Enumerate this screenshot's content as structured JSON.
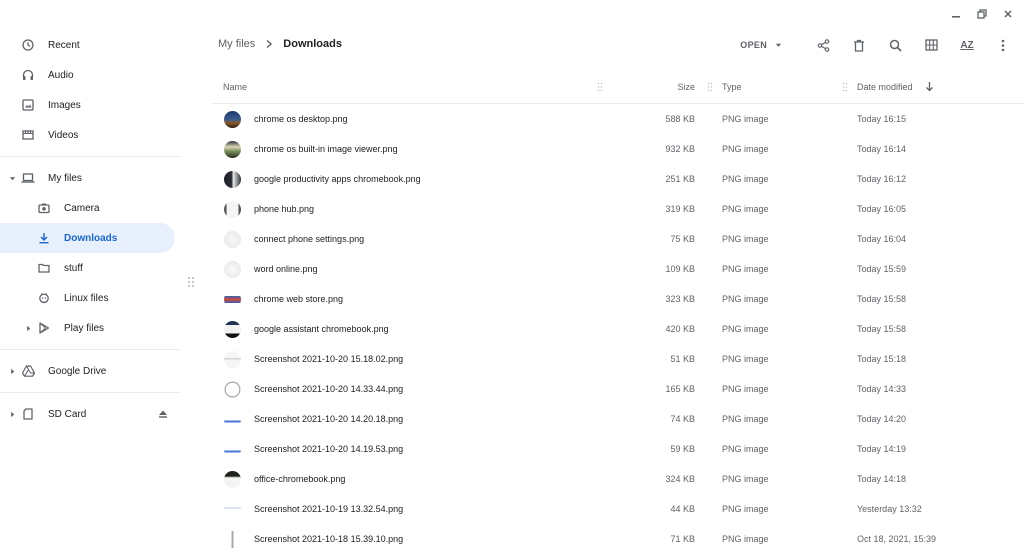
{
  "sidebar": {
    "recent": "Recent",
    "audio": "Audio",
    "images": "Images",
    "videos": "Videos",
    "my_files": "My files",
    "camera": "Camera",
    "downloads": "Downloads",
    "stuff": "stuff",
    "linux_files": "Linux files",
    "play_files": "Play files",
    "google_drive": "Google Drive",
    "sd_card": "SD Card"
  },
  "breadcrumb": {
    "root": "My files",
    "current": "Downloads"
  },
  "toolbar": {
    "open_label": "OPEN",
    "sort_label": "AZ"
  },
  "columns": {
    "name": "Name",
    "size": "Size",
    "type": "Type",
    "date": "Date modified"
  },
  "files": [
    {
      "name": "chrome os desktop.png",
      "size": "588 KB",
      "type": "PNG image",
      "date": "Today 16:15"
    },
    {
      "name": "chrome os built-in image viewer.png",
      "size": "932 KB",
      "type": "PNG image",
      "date": "Today 16:14"
    },
    {
      "name": "google productivity apps chromebook.png",
      "size": "251 KB",
      "type": "PNG image",
      "date": "Today 16:12"
    },
    {
      "name": "phone hub.png",
      "size": "319 KB",
      "type": "PNG image",
      "date": "Today 16:05"
    },
    {
      "name": "connect phone settings.png",
      "size": "75 KB",
      "type": "PNG image",
      "date": "Today 16:04"
    },
    {
      "name": "word online.png",
      "size": "109 KB",
      "type": "PNG image",
      "date": "Today 15:59"
    },
    {
      "name": "chrome web store.png",
      "size": "323 KB",
      "type": "PNG image",
      "date": "Today 15:58"
    },
    {
      "name": "google assistant chromebook.png",
      "size": "420 KB",
      "type": "PNG image",
      "date": "Today 15:58"
    },
    {
      "name": "Screenshot 2021-10-20 15.18.02.png",
      "size": "51 KB",
      "type": "PNG image",
      "date": "Today 15:18"
    },
    {
      "name": "Screenshot 2021-10-20 14.33.44.png",
      "size": "165 KB",
      "type": "PNG image",
      "date": "Today 14:33"
    },
    {
      "name": "Screenshot 2021-10-20 14.20.18.png",
      "size": "74 KB",
      "type": "PNG image",
      "date": "Today 14:20"
    },
    {
      "name": "Screenshot 2021-10-20 14.19.53.png",
      "size": "59 KB",
      "type": "PNG image",
      "date": "Today 14:19"
    },
    {
      "name": "office-chromebook.png",
      "size": "324 KB",
      "type": "PNG image",
      "date": "Today 14:18"
    },
    {
      "name": "Screenshot 2021-10-19 13.32.54.png",
      "size": "44 KB",
      "type": "PNG image",
      "date": "Yesterday 13:32"
    },
    {
      "name": "Screenshot 2021-10-18 15.39.10.png",
      "size": "71 KB",
      "type": "PNG image",
      "date": "Oct 18, 2021, 15:39"
    }
  ],
  "colors": {
    "accent": "#1967d2",
    "active_bg": "#e8f0fe",
    "icon": "#5f6368",
    "text": "#202124"
  }
}
